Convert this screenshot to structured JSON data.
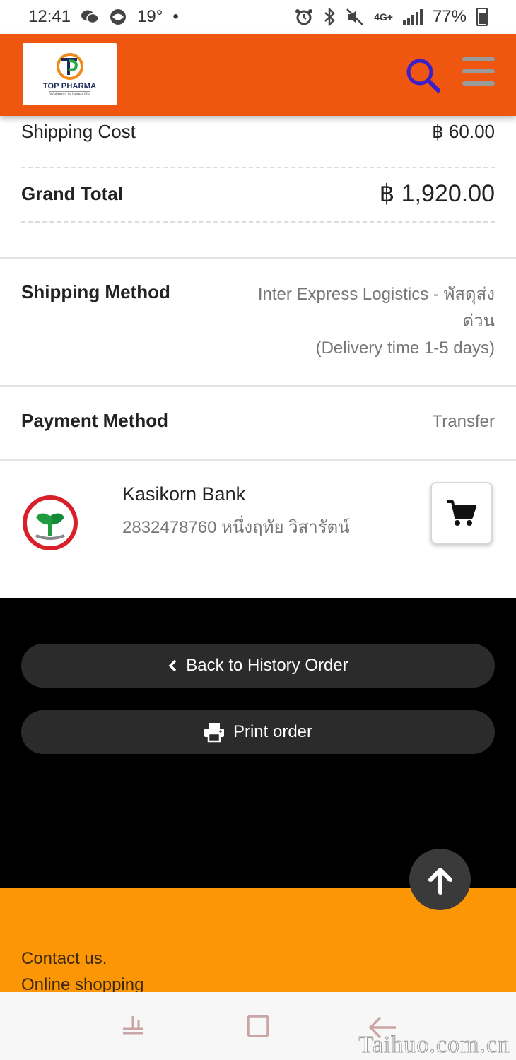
{
  "status_bar": {
    "time": "12:41",
    "temperature": "19°",
    "dot": "•",
    "network": "4G+",
    "battery": "77%"
  },
  "header": {
    "logo_title": "TOP PHARMA",
    "logo_tagline": "Wellness is better life",
    "colors": {
      "header_bg": "#ef560f",
      "search_icon": "#3b1fc8"
    }
  },
  "summary": {
    "shipping_cost_label": "Shipping Cost",
    "shipping_cost_value": "฿ 60.00",
    "grand_total_label": "Grand Total",
    "grand_total_value": "฿ 1,920.00"
  },
  "shipping": {
    "label": "Shipping Method",
    "value_line1": "Inter Express Logistics - พัสดุส่ง",
    "value_line2": "ด่วน",
    "value_line3": "(Delivery time 1-5 days)"
  },
  "payment": {
    "label": "Payment Method",
    "value": "Transfer"
  },
  "bank": {
    "name": "Kasikorn Bank",
    "account": "2832478760 หนึ่งฤทัย วิสารัตน์",
    "icon": "kasikorn-logo"
  },
  "actions": {
    "back_label": "Back to History Order",
    "print_label": "Print order"
  },
  "footer": {
    "contact": "Contact us.",
    "online": "Online shopping"
  },
  "watermark": "Taihuo.com.cn"
}
